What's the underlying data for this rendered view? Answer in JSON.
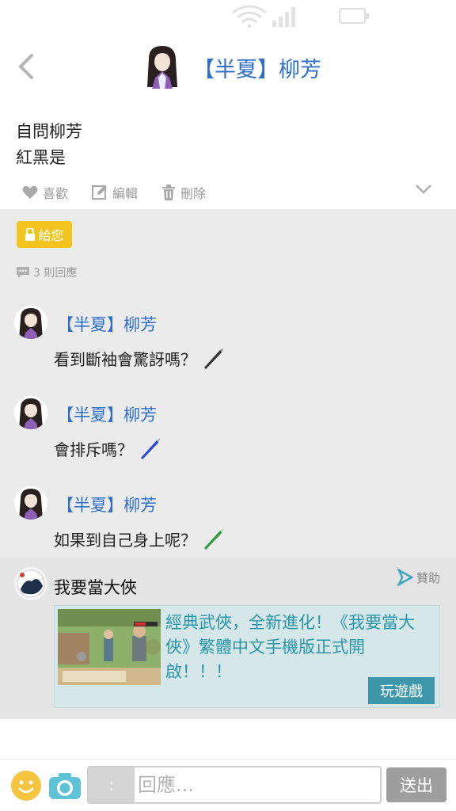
{
  "colors": {
    "accent": "#2f6fc8",
    "badge": "#f2c41f",
    "ad_text": "#2a96a8",
    "play_button": "#3b97a9",
    "send_button": "#9e9e9e"
  },
  "header": {
    "title": "【半夏】柳芳",
    "avatar_icon": "character-avatar-icon",
    "back_icon": "chevron-left-icon"
  },
  "post": {
    "lines": [
      "自問柳芳",
      "紅黑是"
    ]
  },
  "actions": {
    "like": "喜歡",
    "edit": "編輯",
    "delete": "刪除"
  },
  "badge": {
    "label": "給您",
    "icon": "lock-icon"
  },
  "replies_header": {
    "count_text": "3 則回應",
    "icon": "comment-icon"
  },
  "replies": [
    {
      "name": "【半夏】柳芳",
      "text": "看到斷袖會驚訝嗎？",
      "sticker": "black-pen-icon"
    },
    {
      "name": "【半夏】柳芳",
      "text": "會排斥嗎？",
      "sticker": "blue-pen-icon"
    },
    {
      "name": "【半夏】柳芳",
      "text": "如果到自己身上呢？",
      "sticker": "green-pen-icon"
    }
  ],
  "ad": {
    "name": "我要當大俠",
    "sponsor": "贊助",
    "description": "經典武俠，全新進化！《我要當大俠》繁體中文手機版正式開啟！！！",
    "cta": "玩遊戲"
  },
  "composer": {
    "prefix": ":",
    "placeholder": "回應...",
    "send": "送出"
  }
}
